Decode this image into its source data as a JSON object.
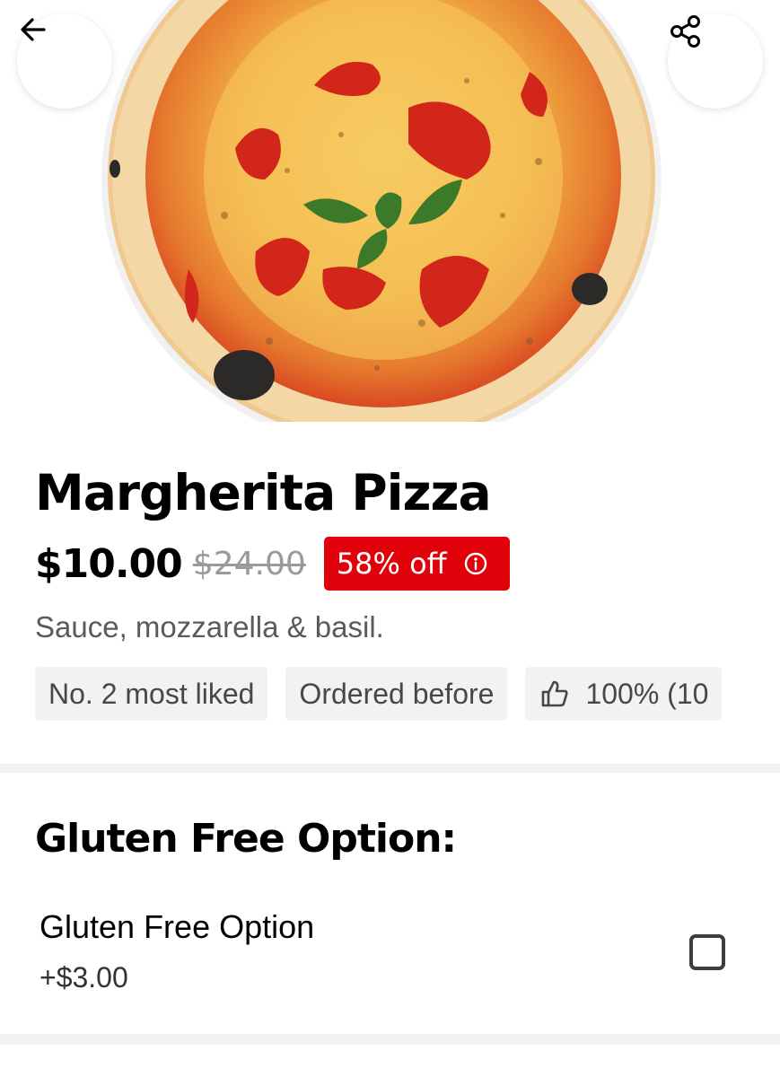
{
  "product": {
    "title": "Margherita Pizza",
    "price": "$10.00",
    "original_price": "$24.00",
    "discount_label": "58% off",
    "description": "Sauce, mozzarella & basil."
  },
  "chips": [
    {
      "label": "No. 2 most liked"
    },
    {
      "label": "Ordered before"
    },
    {
      "label": "100% (10",
      "icon": "thumbs-up-icon"
    }
  ],
  "options_section": {
    "title": "Gluten Free Option:",
    "options": [
      {
        "name": "Gluten Free Option",
        "price": "+$3.00",
        "checked": false
      }
    ]
  },
  "icons": {
    "back": "arrow-left-icon",
    "share": "share-icon",
    "info": "info-icon"
  },
  "colors": {
    "discount_badge": "#e0010b",
    "chip_bg": "#f2f2f2",
    "divider": "#f2f2f2"
  }
}
